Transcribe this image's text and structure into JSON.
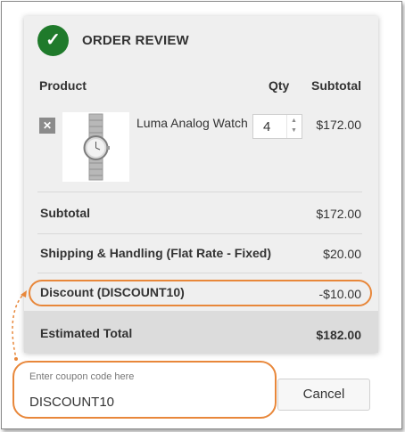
{
  "header": {
    "title": "ORDER REVIEW",
    "icon": "check-icon",
    "icon_color": "#1f7a2b"
  },
  "table": {
    "headers": {
      "product": "Product",
      "qty": "Qty",
      "subtotal": "Subtotal"
    },
    "items": [
      {
        "name": "Luma Analog Watch",
        "qty": "4",
        "subtotal": "$172.00",
        "remove_icon": "close-icon"
      }
    ]
  },
  "totals": {
    "subtotal_label": "Subtotal",
    "subtotal_value": "$172.00",
    "shipping_label": "Shipping & Handling (Flat Rate - Fixed)",
    "shipping_value": "$20.00",
    "discount_label": "Discount (DISCOUNT10)",
    "discount_value": "-$10.00",
    "total_label": "Estimated Total",
    "total_value": "$182.00"
  },
  "coupon": {
    "placeholder": "Enter coupon code here",
    "value": "DISCOUNT10",
    "cancel_label": "Cancel"
  },
  "colors": {
    "highlight": "#e8873a",
    "panel": "#efefef",
    "total_bar": "#dcdcdc"
  }
}
